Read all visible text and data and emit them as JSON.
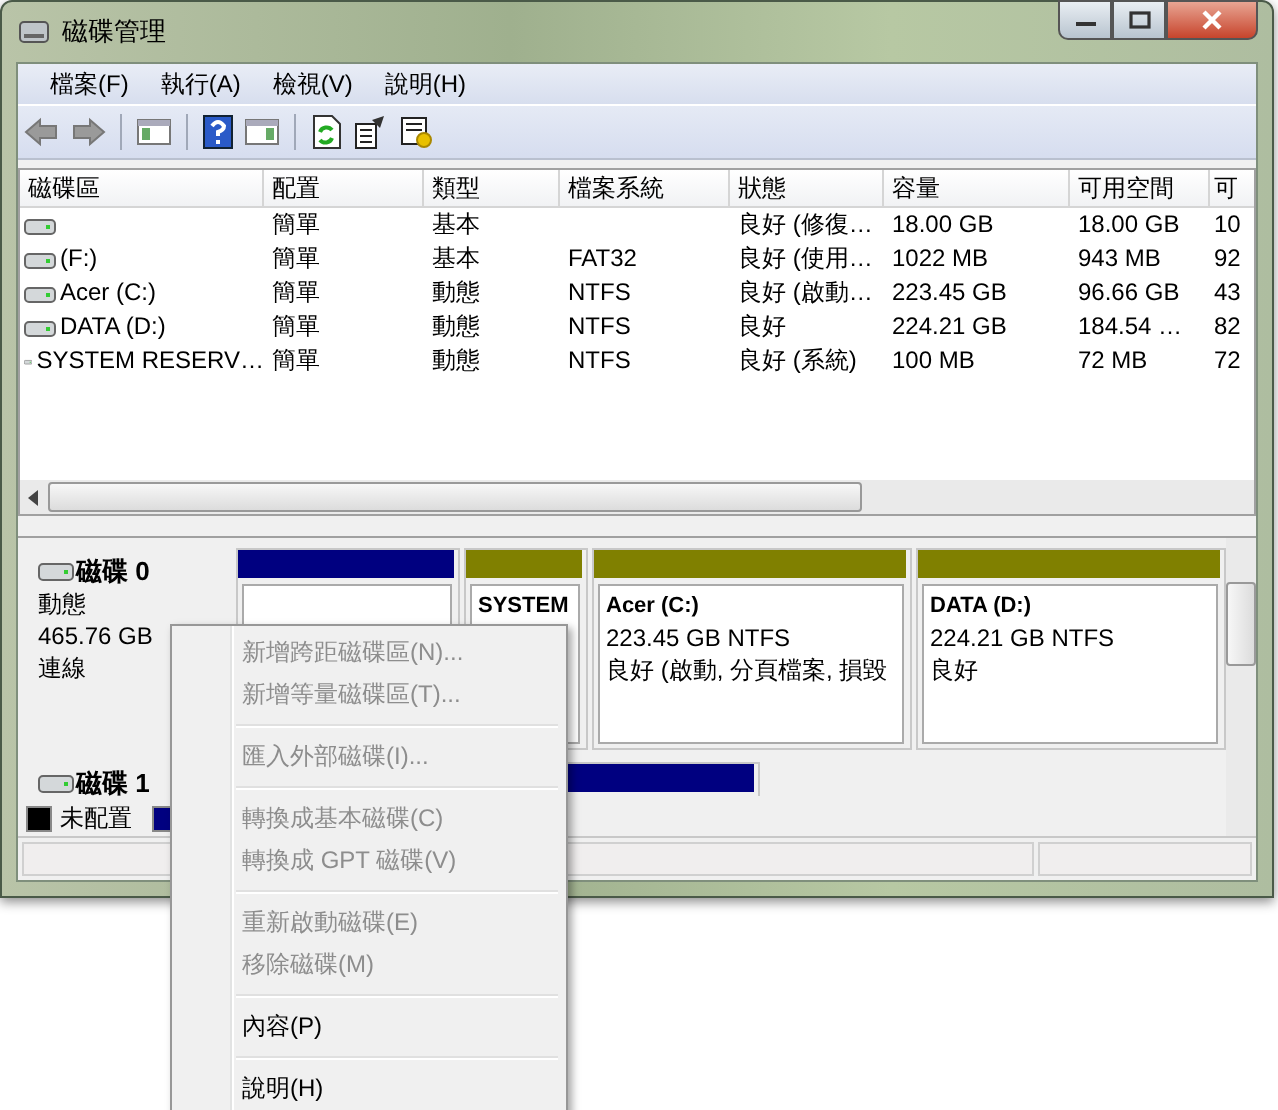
{
  "window": {
    "title": "磁碟管理"
  },
  "menu_bar": [
    "檔案(F)",
    "執行(A)",
    "檢視(V)",
    "說明(H)"
  ],
  "volume_list": {
    "columns": [
      "磁碟區",
      "配置",
      "類型",
      "檔案系統",
      "狀態",
      "容量",
      "可用空間",
      "可"
    ],
    "rows": [
      [
        "",
        "簡單",
        "基本",
        "",
        "良好 (修復…",
        "18.00 GB",
        "18.00 GB",
        "10"
      ],
      [
        "(F:)",
        "簡單",
        "基本",
        "FAT32",
        "良好 (使用…",
        "1022 MB",
        "943 MB",
        "92"
      ],
      [
        "Acer (C:)",
        "簡單",
        "動態",
        "NTFS",
        "良好 (啟動…",
        "223.45 GB",
        "96.66 GB",
        "43"
      ],
      [
        "DATA (D:)",
        "簡單",
        "動態",
        "NTFS",
        "良好",
        "224.21 GB",
        "184.54 …",
        "82"
      ],
      [
        "SYSTEM RESERV…",
        "簡單",
        "動態",
        "NTFS",
        "良好 (系統)",
        "100 MB",
        "72 MB",
        "72"
      ]
    ]
  },
  "disks": [
    {
      "name": "磁碟 0",
      "details": [
        "動態",
        "465.76 GB",
        "連線"
      ],
      "partitions": [
        {
          "color": "#000080"
        },
        {
          "color": "#808000",
          "name": "SYSTEM"
        },
        {
          "color": "#808000",
          "name": "Acer  (C:)",
          "lines": [
            "223.45 GB NTFS",
            "良好 (啟動, 分頁檔案, 損毀"
          ]
        },
        {
          "color": "#808000",
          "name": "DATA  (D:)",
          "lines": [
            "224.21 GB NTFS",
            "良好"
          ]
        }
      ]
    },
    {
      "name": "磁碟 1",
      "partitions": [
        {
          "color": "#000080"
        }
      ]
    }
  ],
  "legend": [
    {
      "label": "未配置",
      "color": "#000000"
    },
    {
      "color": "#000080"
    }
  ],
  "context_menu": {
    "items": [
      {
        "kind": "item",
        "label": "新增跨距磁碟區(N)...",
        "disabled": true
      },
      {
        "kind": "item",
        "label": "新增等量磁碟區(T)...",
        "disabled": true
      },
      {
        "kind": "separator"
      },
      {
        "kind": "item",
        "label": "匯入外部磁碟(I)...",
        "disabled": true
      },
      {
        "kind": "separator"
      },
      {
        "kind": "item",
        "label": "轉換成基本磁碟(C)",
        "disabled": true
      },
      {
        "kind": "item",
        "label": "轉換成 GPT 磁碟(V)",
        "disabled": true
      },
      {
        "kind": "separator"
      },
      {
        "kind": "item",
        "label": "重新啟動磁碟(E)",
        "disabled": true
      },
      {
        "kind": "item",
        "label": "移除磁碟(M)",
        "disabled": true
      },
      {
        "kind": "separator"
      },
      {
        "kind": "item",
        "label": "內容(P)",
        "disabled": false
      },
      {
        "kind": "separator"
      },
      {
        "kind": "item",
        "label": "說明(H)",
        "disabled": false
      }
    ]
  }
}
